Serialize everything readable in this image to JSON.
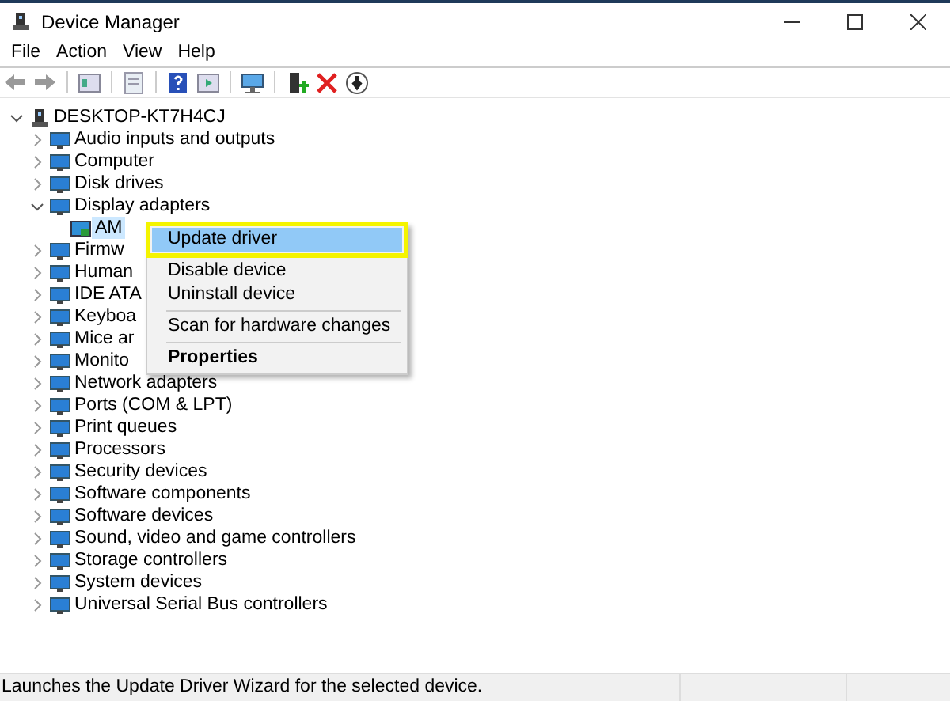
{
  "window": {
    "title": "Device Manager"
  },
  "menu_bar": [
    "File",
    "Action",
    "View",
    "Help"
  ],
  "tree": {
    "label": "DESKTOP-KT7H4CJ",
    "expanded": true,
    "children": [
      {
        "label": "Audio inputs and outputs",
        "expanded": false
      },
      {
        "label": "Computer",
        "expanded": false
      },
      {
        "label": "Disk drives",
        "expanded": false
      },
      {
        "label": "Display adapters",
        "expanded": true,
        "children": [
          {
            "label": "AM",
            "selected": true
          }
        ]
      },
      {
        "label": "Firmw",
        "expanded": false
      },
      {
        "label": "Human",
        "expanded": false
      },
      {
        "label": "IDE ATA",
        "expanded": false
      },
      {
        "label": "Keyboa",
        "expanded": false
      },
      {
        "label": "Mice ar",
        "expanded": false
      },
      {
        "label": "Monito",
        "expanded": false
      },
      {
        "label": "Network adapters",
        "expanded": false
      },
      {
        "label": "Ports (COM & LPT)",
        "expanded": false
      },
      {
        "label": "Print queues",
        "expanded": false
      },
      {
        "label": "Processors",
        "expanded": false
      },
      {
        "label": "Security devices",
        "expanded": false
      },
      {
        "label": "Software components",
        "expanded": false
      },
      {
        "label": "Software devices",
        "expanded": false
      },
      {
        "label": "Sound, video and game controllers",
        "expanded": false
      },
      {
        "label": "Storage controllers",
        "expanded": false
      },
      {
        "label": "System devices",
        "expanded": false
      },
      {
        "label": "Universal Serial Bus controllers",
        "expanded": false
      }
    ]
  },
  "context_menu": [
    {
      "kind": "item",
      "label": "Update driver",
      "selected": true,
      "annotated": true
    },
    {
      "kind": "item",
      "label": "Disable device",
      "selected": false
    },
    {
      "kind": "item",
      "label": "Uninstall device",
      "selected": false
    },
    {
      "kind": "separator"
    },
    {
      "kind": "item",
      "label": "Scan for hardware changes",
      "selected": false
    },
    {
      "kind": "separator"
    },
    {
      "kind": "default",
      "label": "Properties",
      "selected": false
    }
  ],
  "status_bar": "Launches the Update Driver Wizard for the selected device."
}
